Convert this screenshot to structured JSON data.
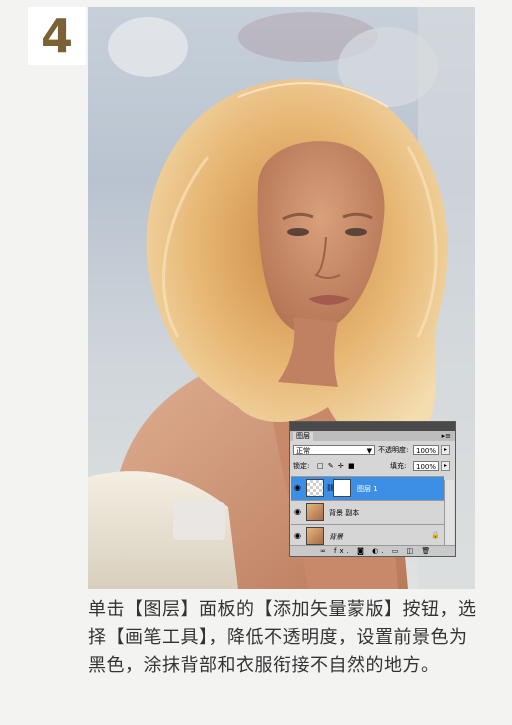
{
  "step": {
    "number": "4"
  },
  "panel": {
    "tab": "图层",
    "menu_glyph": "▸≡",
    "blend_mode": "正常",
    "opacity_label": "不透明度:",
    "opacity_value": "100%",
    "lock_label": "锁定:",
    "lock_icons": "□ ✎ ✛ ■",
    "fill_label": "填充:",
    "fill_value": "100%",
    "layers": [
      {
        "name": "图层 1",
        "selected": true
      },
      {
        "name": "背景 副本",
        "selected": false
      },
      {
        "name": "背景",
        "selected": false
      }
    ],
    "bottom_icons": "∞ fx. ◙ ◐. ▭ ◫ 🗑"
  },
  "caption": {
    "text": "单击【图层】面板的【添加矢量蒙版】按钮，选择【画笔工具】，降低不透明度，设置前景色为黑色，涂抹背部和衣服衔接不自然的地方。"
  },
  "colors": {
    "step_number": "#7a6236",
    "selection": "#3d8fe6",
    "caption": "#333333"
  }
}
